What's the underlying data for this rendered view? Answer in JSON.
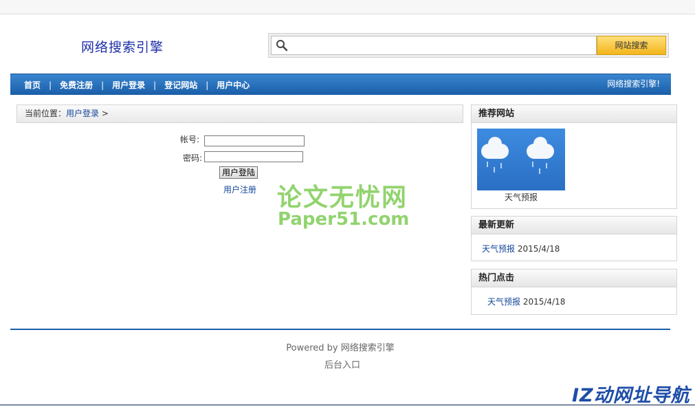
{
  "header": {
    "logo_text": "网络搜索引擎",
    "search_placeholder": "",
    "search_button": "网站搜索"
  },
  "nav": {
    "items": [
      {
        "label": "首页"
      },
      {
        "label": "免费注册"
      },
      {
        "label": "用户登录"
      },
      {
        "label": "登记网站"
      },
      {
        "label": "用户中心"
      }
    ],
    "separator": "|",
    "right_text": "网络搜索引擎!"
  },
  "breadcrumb": {
    "prefix": "当前位置：",
    "current": "用户登录",
    "suffix": " >"
  },
  "login": {
    "account_label": "帐号:",
    "password_label": "密码:",
    "login_button": "用户登陆",
    "register_link": "用户注册"
  },
  "watermark": {
    "line1": "论文无忧网",
    "line2": "Paper51.com",
    "corner": "IZ动网址导航"
  },
  "sidebar": {
    "recommended": {
      "title": "推荐网站",
      "item_caption": "天气预报"
    },
    "latest": {
      "title": "最新更新",
      "item_label": "天气预报",
      "item_date": "2015/4/18"
    },
    "hot": {
      "title": "热门点击",
      "item_label": "天气预报",
      "item_date": "2015/4/18"
    }
  },
  "footer": {
    "powered_by": "Powered by 网络搜索引擎",
    "admin_link": "后台入口"
  },
  "colors": {
    "nav_blue": "#1a5ea8",
    "logo_blue": "#1c2ea8",
    "link_blue": "#15479a",
    "search_button_yellow": "#f3b51b",
    "watermark_green": "#7fcc55"
  }
}
